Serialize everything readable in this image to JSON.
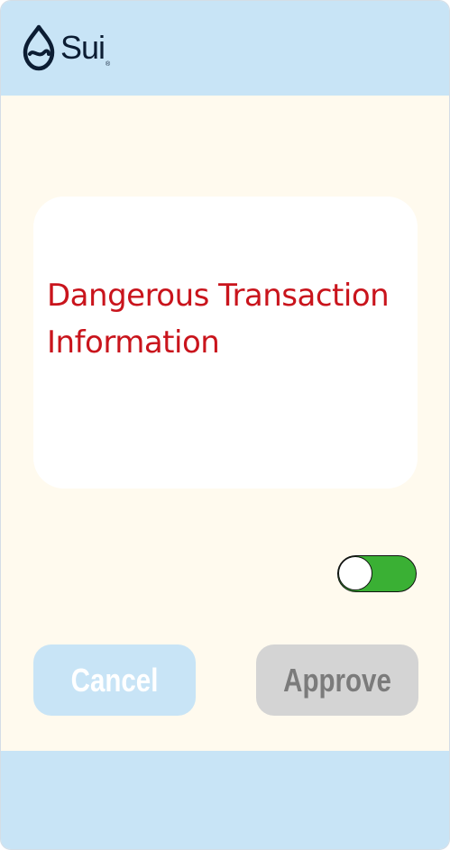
{
  "header": {
    "logo_text": "Sui",
    "logo_mark": "®"
  },
  "warning": {
    "text": "Dangerous Transaction Information"
  },
  "toggle": {
    "state": "on"
  },
  "buttons": {
    "cancel_label": "Cancel",
    "approve_label": "Approve"
  },
  "colors": {
    "header_bg": "#c8e4f6",
    "main_bg": "#fffaee",
    "warning_text": "#c9141c",
    "toggle_on": "#3ab034",
    "cancel_bg": "#c8e4f6",
    "approve_bg": "#d4d4d4"
  }
}
